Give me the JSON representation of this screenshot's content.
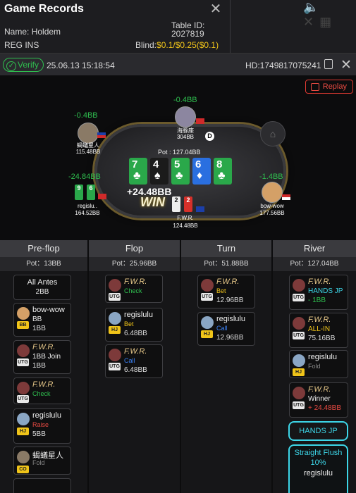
{
  "header": {
    "title": "Game Records",
    "name_label": "Name:",
    "name_value": "Holdem",
    "reg": "REG INS",
    "table_id_label": "Table ID:",
    "table_id": "2027819",
    "blind_label": "Blind:",
    "blind_value": "$0.1/$0.25($0.1)"
  },
  "verify_bar": {
    "verify_label": "Verify",
    "datetime": "25.06.13 15:18:54",
    "hand_id": "HD:1749817075241"
  },
  "table": {
    "replay_label": "Replay",
    "pot": "Pot : 127.04BB",
    "board": [
      {
        "rank": "7",
        "suit": "♣",
        "color": "green"
      },
      {
        "rank": "4",
        "suit": "♠",
        "color": "black"
      },
      {
        "rank": "5",
        "suit": "♣",
        "color": "green"
      },
      {
        "rank": "6",
        "suit": "♦",
        "color": "blue"
      },
      {
        "rank": "8",
        "suit": "♣",
        "color": "green"
      }
    ],
    "winner_gain": "+24.48BB",
    "win_label": "WIN",
    "dealer_label": "D",
    "players": {
      "top_left": {
        "name": "蝎蟻星人",
        "stack": "115.48BB",
        "pl": "-0.4BB"
      },
      "top": {
        "name": "海豚座",
        "stack": "304BB",
        "pl": "-0.4BB"
      },
      "left": {
        "name": "regislu..",
        "stack": "164.52BB",
        "pl": "-24.84BB",
        "cards": [
          "9",
          "6"
        ]
      },
      "right": {
        "name": "bow-wow",
        "stack": "177.56BB",
        "pl": "-1.4BB"
      },
      "bottom": {
        "name": "F.W.R.",
        "stack": "124.48BB",
        "cards": [
          "2",
          "2"
        ]
      }
    }
  },
  "streets": [
    {
      "name": "Pre-flop",
      "pot": "Pot：13BB"
    },
    {
      "name": "Flop",
      "pot": "Pot：25.96BB"
    },
    {
      "name": "Turn",
      "pot": "Pot：51.88BB"
    },
    {
      "name": "River",
      "pot": "Pot：127.04BB"
    }
  ],
  "preflop": {
    "antes_label": "All Antes",
    "antes_amount": "2BB",
    "actions": [
      {
        "name": "bow-wow",
        "pos": "BB",
        "action": "BB",
        "amount": "1BB"
      },
      {
        "name": "F.W.R.",
        "pos": "UTG",
        "action": "1BB Join",
        "amount": "1BB"
      },
      {
        "name": "F.W.R.",
        "pos": "UTG",
        "action": "Check",
        "amount": ""
      },
      {
        "name": "regislulu",
        "pos": "HJ",
        "action": "Raise",
        "amount": "5BB"
      },
      {
        "name": "蝎蟻星人",
        "pos": "CO",
        "action": "Fold",
        "amount": ""
      }
    ]
  },
  "flop": {
    "actions": [
      {
        "name": "F.W.R.",
        "pos": "UTG",
        "action": "Check",
        "amount": ""
      },
      {
        "name": "regislulu",
        "pos": "HJ",
        "action": "Bet",
        "amount": "6.48BB"
      },
      {
        "name": "F.W.R.",
        "pos": "UTG",
        "action": "Call",
        "amount": "6.48BB"
      }
    ]
  },
  "turn": {
    "actions": [
      {
        "name": "F.W.R.",
        "pos": "UTG",
        "action": "Bet",
        "amount": "12.96BB"
      },
      {
        "name": "regislulu",
        "pos": "HJ",
        "action": "Call",
        "amount": "12.96BB"
      }
    ]
  },
  "river": {
    "actions": [
      {
        "name": "F.W.R.",
        "pos": "UTG",
        "action": "HANDS JP",
        "amount": "- 1BB"
      },
      {
        "name": "F.W.R.",
        "pos": "UTG",
        "action": "ALL-IN",
        "amount": "75.16BB"
      },
      {
        "name": "regislulu",
        "pos": "HJ",
        "action": "Fold",
        "amount": ""
      },
      {
        "name": "F.W.R.",
        "pos": "UTG",
        "action": "Winner",
        "amount": "+ 24.48BB"
      }
    ],
    "jp_button": "HANDS JP",
    "jp_hand": "Straight Flush",
    "jp_pct": "10%",
    "jp_player": "regislulu"
  },
  "colors": {
    "accent_green": "#2fbf4f",
    "accent_red": "#e84a42",
    "accent_cyan": "#3dd6e8",
    "gold": "#f0c419"
  }
}
